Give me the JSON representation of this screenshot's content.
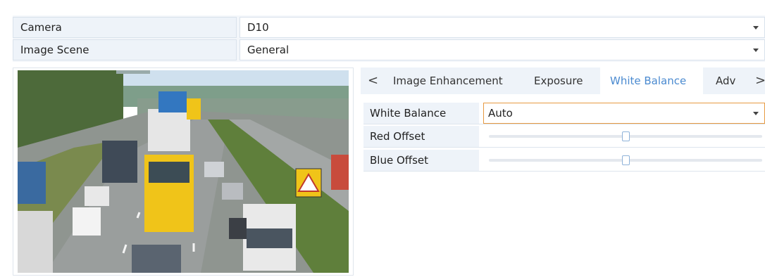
{
  "camera": {
    "label": "Camera",
    "value": "D10"
  },
  "image_scene": {
    "label": "Image Scene",
    "value": "General"
  },
  "preview": {
    "alt_icon": "camera-live-image"
  },
  "tabs": {
    "prev_arrow": "<",
    "next_arrow": ">",
    "items": [
      {
        "label": "Image Enhancement",
        "active": false
      },
      {
        "label": "Exposure",
        "active": false
      },
      {
        "label": "White Balance",
        "active": true
      },
      {
        "label": "Adv",
        "active": false
      }
    ]
  },
  "white_balance": {
    "mode": {
      "label": "White Balance",
      "value": "Auto"
    },
    "red_offset": {
      "label": "Red Offset",
      "level": 0.5
    },
    "blue_offset": {
      "label": "Blue Offset",
      "level": 0.5
    }
  },
  "colors": {
    "accent": "#4a8ad0",
    "focus_border": "#e79a42"
  }
}
